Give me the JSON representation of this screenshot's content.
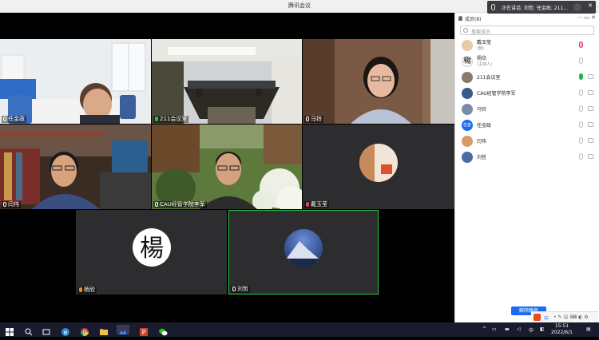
{
  "window": {
    "title": "腾讯会议"
  },
  "notification": {
    "text": "正在讲话: 刘哲; 任金政; 211..."
  },
  "tiles": [
    {
      "name": "任金政"
    },
    {
      "name": "211会议室"
    },
    {
      "name": "马铃"
    },
    {
      "name": "闫伟"
    },
    {
      "name": "CAU经管学院李军"
    },
    {
      "name": "戴玉莹"
    },
    {
      "name": "杨欣"
    },
    {
      "name": "刘哲"
    }
  ],
  "sidebar": {
    "header": "成员(8)",
    "search_placeholder": "搜索成员",
    "members": [
      {
        "name": "戴玉莹",
        "sub": "(我)",
        "mic": "red"
      },
      {
        "name": "杨欣",
        "sub": "(主持人)",
        "mic": "normal"
      },
      {
        "name": "211会议室",
        "sub": "",
        "mic": "green"
      },
      {
        "name": "CAU经管学院李军",
        "sub": "",
        "mic": "normal"
      },
      {
        "name": "马铃",
        "sub": "",
        "mic": "normal"
      },
      {
        "name": "任金政",
        "sub": "",
        "mic": "normal"
      },
      {
        "name": "闫伟",
        "sub": "",
        "mic": "normal"
      },
      {
        "name": "刘哲",
        "sub": "",
        "mic": "normal"
      }
    ],
    "unmute_label": "解除静音"
  },
  "ime": {
    "lang": "中"
  },
  "taskbar": {
    "time": "15:51",
    "date": "2022/6/1",
    "tray_lang": "中"
  },
  "colors": {
    "accent": "#1a6bf0",
    "speaking_border": "#28c840"
  }
}
